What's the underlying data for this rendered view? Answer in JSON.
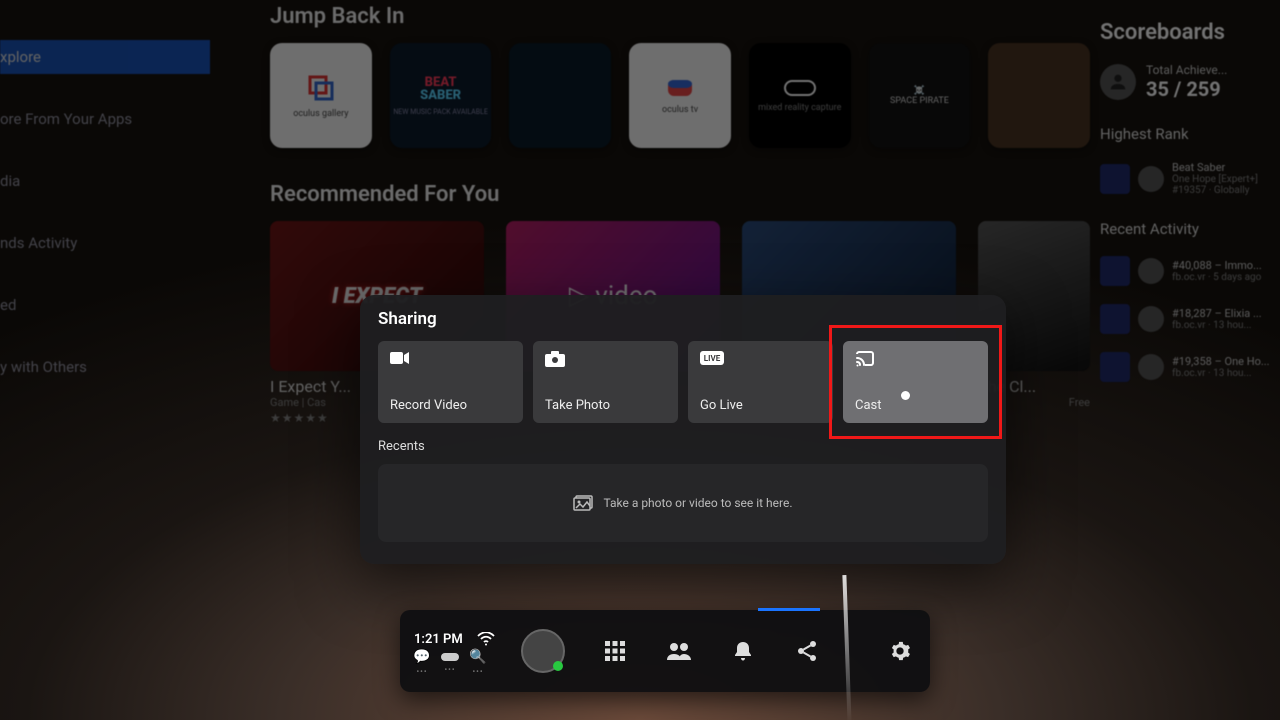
{
  "sidebar": {
    "items": [
      {
        "label": "xplore",
        "active": true
      },
      {
        "label": "ore From Your Apps"
      },
      {
        "label": "dia"
      },
      {
        "label": "nds Activity"
      },
      {
        "label": "ed"
      },
      {
        "label": "y with Others"
      }
    ]
  },
  "sections": {
    "jump_back": {
      "title": "Jump Back In",
      "tiles": [
        {
          "label": "oculus gallery",
          "style": "white"
        },
        {
          "label": "BEAT SABER",
          "sub": "NEW MUSIC PACK AVAILABLE",
          "style": "navy"
        },
        {
          "label": "",
          "style": "dark"
        },
        {
          "label": "oculus tv",
          "style": "white"
        },
        {
          "label": "mixed reality capture",
          "style": "plain"
        },
        {
          "label": "SPACE PIRATE",
          "style": "plain"
        },
        {
          "label": "",
          "style": "plain"
        }
      ]
    },
    "recommended": {
      "title": "Recommended For You",
      "cards": [
        {
          "title": "I Expect Y...",
          "sub": "Game | Cas",
          "thumb_text": "I EXPECT",
          "style": "red"
        },
        {
          "title": "",
          "sub": "",
          "thumb_text": "video",
          "style": "pink"
        },
        {
          "title": "",
          "sub": "",
          "thumb_text": "",
          "style": "blue"
        },
        {
          "title": "The Cl...",
          "sub": "Free",
          "thumb_text": "",
          "style": "dark"
        }
      ]
    }
  },
  "scoreboard": {
    "title": "Scoreboards",
    "achieve_label": "Total Achieve...",
    "achieve_value": "35 / 259",
    "highest_rank_label": "Highest Rank",
    "hr_game": "Beat Saber",
    "hr_sub": "One Hope [Expert+]",
    "hr_rank": "#19357 · Globally",
    "recent_label": "Recent Activity",
    "recent": [
      {
        "rank": "#40,088 – Immo...",
        "sub": "fb.oc.vr · 5 days ago"
      },
      {
        "rank": "#18,287 – Elixia ...",
        "sub": "fb.oc.vr · 13 hou..."
      },
      {
        "rank": "#19,358 – One Ho...",
        "sub": "fb.oc.vr · 13 hou..."
      }
    ]
  },
  "modal": {
    "title": "Sharing",
    "buttons": [
      {
        "label": "Record Video",
        "icon": "record-icon"
      },
      {
        "label": "Take Photo",
        "icon": "camera-icon"
      },
      {
        "label": "Go Live",
        "icon": "live-icon"
      },
      {
        "label": "Cast",
        "icon": "cast-icon",
        "hover": true,
        "highlighted": true
      }
    ],
    "recents_title": "Recents",
    "recents_empty": "Take a photo or video to see it here."
  },
  "dock": {
    "time": "1:21 PM"
  }
}
